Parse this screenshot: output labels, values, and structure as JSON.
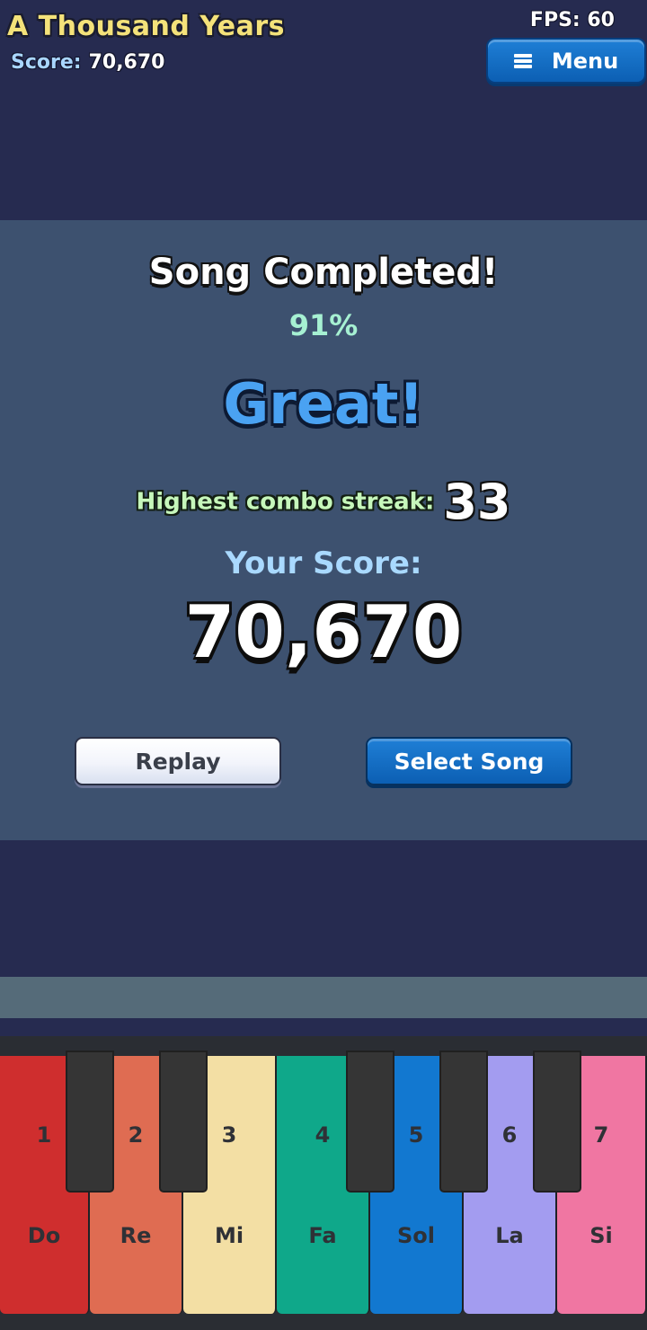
{
  "header": {
    "song_title": "A Thousand Years",
    "score_label": "Score:",
    "score_value": "70,670",
    "fps_readout": "FPS: 60",
    "menu_label": "Menu"
  },
  "result": {
    "title": "Song Completed!",
    "accuracy": "91%",
    "rating": "Great!",
    "combo_label": "Highest combo streak:",
    "combo_value": "33",
    "your_score_label": "Your Score:",
    "final_score": "70,670",
    "replay_label": "Replay",
    "select_song_label": "Select Song"
  },
  "piano": {
    "keys": [
      {
        "number": "1",
        "note": "Do",
        "color": "#cf2e2e"
      },
      {
        "number": "2",
        "note": "Re",
        "color": "#df6c52"
      },
      {
        "number": "3",
        "note": "Mi",
        "color": "#f3dfa4"
      },
      {
        "number": "4",
        "note": "Fa",
        "color": "#0fa88a"
      },
      {
        "number": "5",
        "note": "Sol",
        "color": "#1278d0"
      },
      {
        "number": "6",
        "note": "La",
        "color": "#a39cf0"
      },
      {
        "number": "7",
        "note": "Si",
        "color": "#f076a2"
      }
    ],
    "black_key_color": "#353535"
  },
  "colors": {
    "background": "#262b50",
    "panel": "#3d516f",
    "track_bar": "#556b79",
    "accent_blue": "#1f7fd6"
  }
}
